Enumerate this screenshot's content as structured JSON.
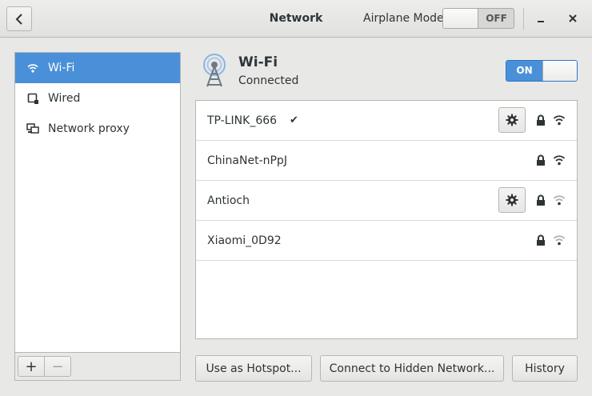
{
  "window": {
    "title": "Network",
    "airplane_mode_label": "Airplane Mode",
    "airplane_mode_state": "OFF"
  },
  "sidebar": {
    "items": [
      {
        "label": "Wi-Fi",
        "icon": "wifi-icon",
        "selected": true
      },
      {
        "label": "Wired",
        "icon": "wired-icon",
        "selected": false
      },
      {
        "label": "Network proxy",
        "icon": "network-proxy-icon",
        "selected": false
      }
    ],
    "add_label": "+",
    "remove_label": "−"
  },
  "wifi": {
    "title": "Wi-Fi",
    "status": "Connected",
    "switch_state": "ON"
  },
  "networks": [
    {
      "name": "TP-LINK_666",
      "connected": true,
      "check": "✔",
      "has_settings": true,
      "secured": true,
      "signal": "strong"
    },
    {
      "name": "ChinaNet-nPpJ",
      "connected": false,
      "has_settings": false,
      "secured": true,
      "signal": "strong"
    },
    {
      "name": "Antioch",
      "connected": false,
      "has_settings": true,
      "secured": true,
      "signal": "weak"
    },
    {
      "name": "Xiaomi_0D92",
      "connected": false,
      "has_settings": false,
      "secured": true,
      "signal": "weak"
    }
  ],
  "footer": {
    "hotspot_label": "Use as Hotspot...",
    "hidden_label": "Connect to Hidden Network...",
    "history_label": "History"
  },
  "colors": {
    "accent": "#4a90d9",
    "window_bg": "#e8e8e7"
  }
}
